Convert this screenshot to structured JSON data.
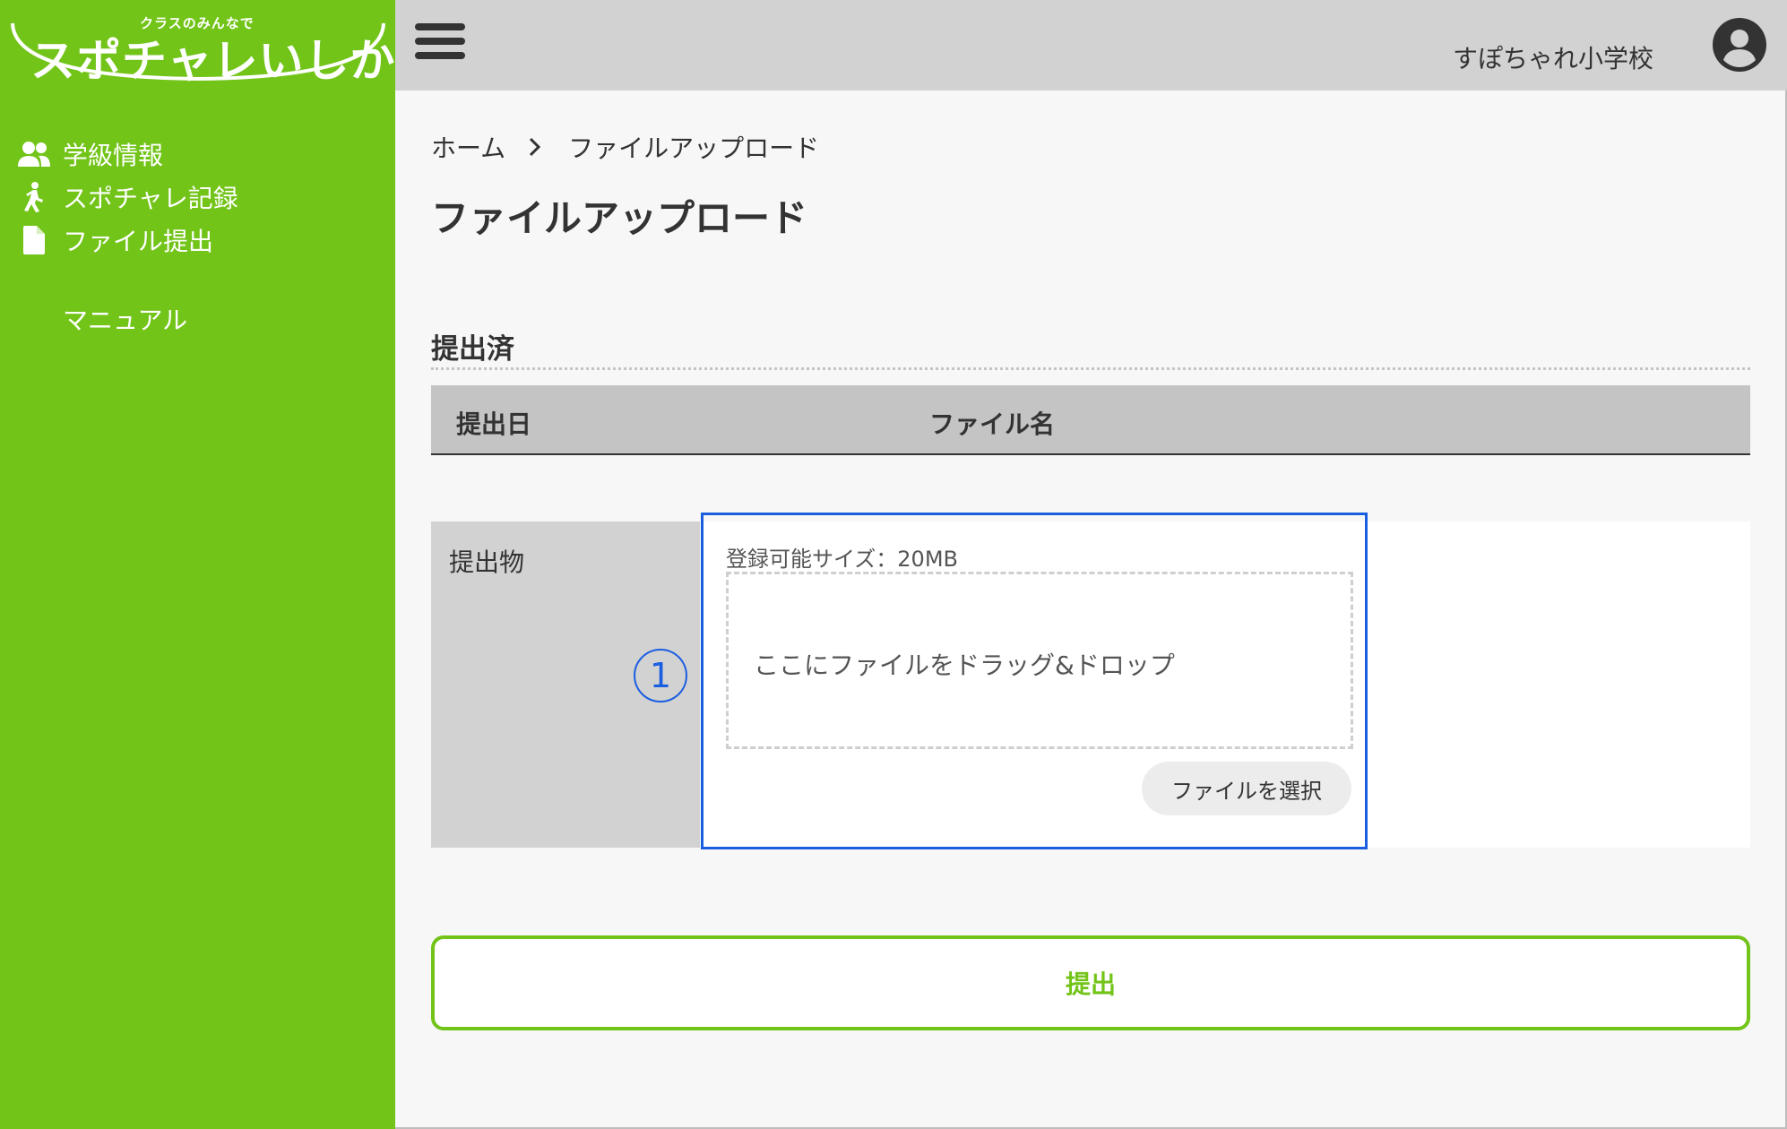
{
  "colors": {
    "brand_green": "#72c419",
    "header_gray": "#d2d2d2",
    "highlight_blue": "#1a5ee0"
  },
  "logo": {
    "tagline": "クラスのみんなで",
    "name": "スポチャレいしかわ"
  },
  "sidebar": {
    "items": [
      {
        "label": "学級情報",
        "icon": "users-icon"
      },
      {
        "label": "スポチャレ記録",
        "icon": "walking-icon"
      },
      {
        "label": "ファイル提出",
        "icon": "file-icon"
      }
    ],
    "manual_label": "マニュアル"
  },
  "header": {
    "menu_icon": "hamburger-icon",
    "school_name": "すぽちゃれ小学校",
    "account_icon": "user-circle-icon"
  },
  "breadcrumb": {
    "home": "ホーム",
    "current": "ファイルアップロード"
  },
  "page": {
    "title": "ファイルアップロード"
  },
  "submitted": {
    "section_title": "提出済",
    "columns": [
      "提出日",
      "ファイル名"
    ]
  },
  "upload": {
    "row_label": "提出物",
    "size_label": "登録可能サイズ：20MB",
    "dropzone_text": "ここにファイルをドラッグ&ドロップ",
    "choose_button": "ファイルを選択",
    "annotation_marker": "1"
  },
  "submit_button": "提出"
}
